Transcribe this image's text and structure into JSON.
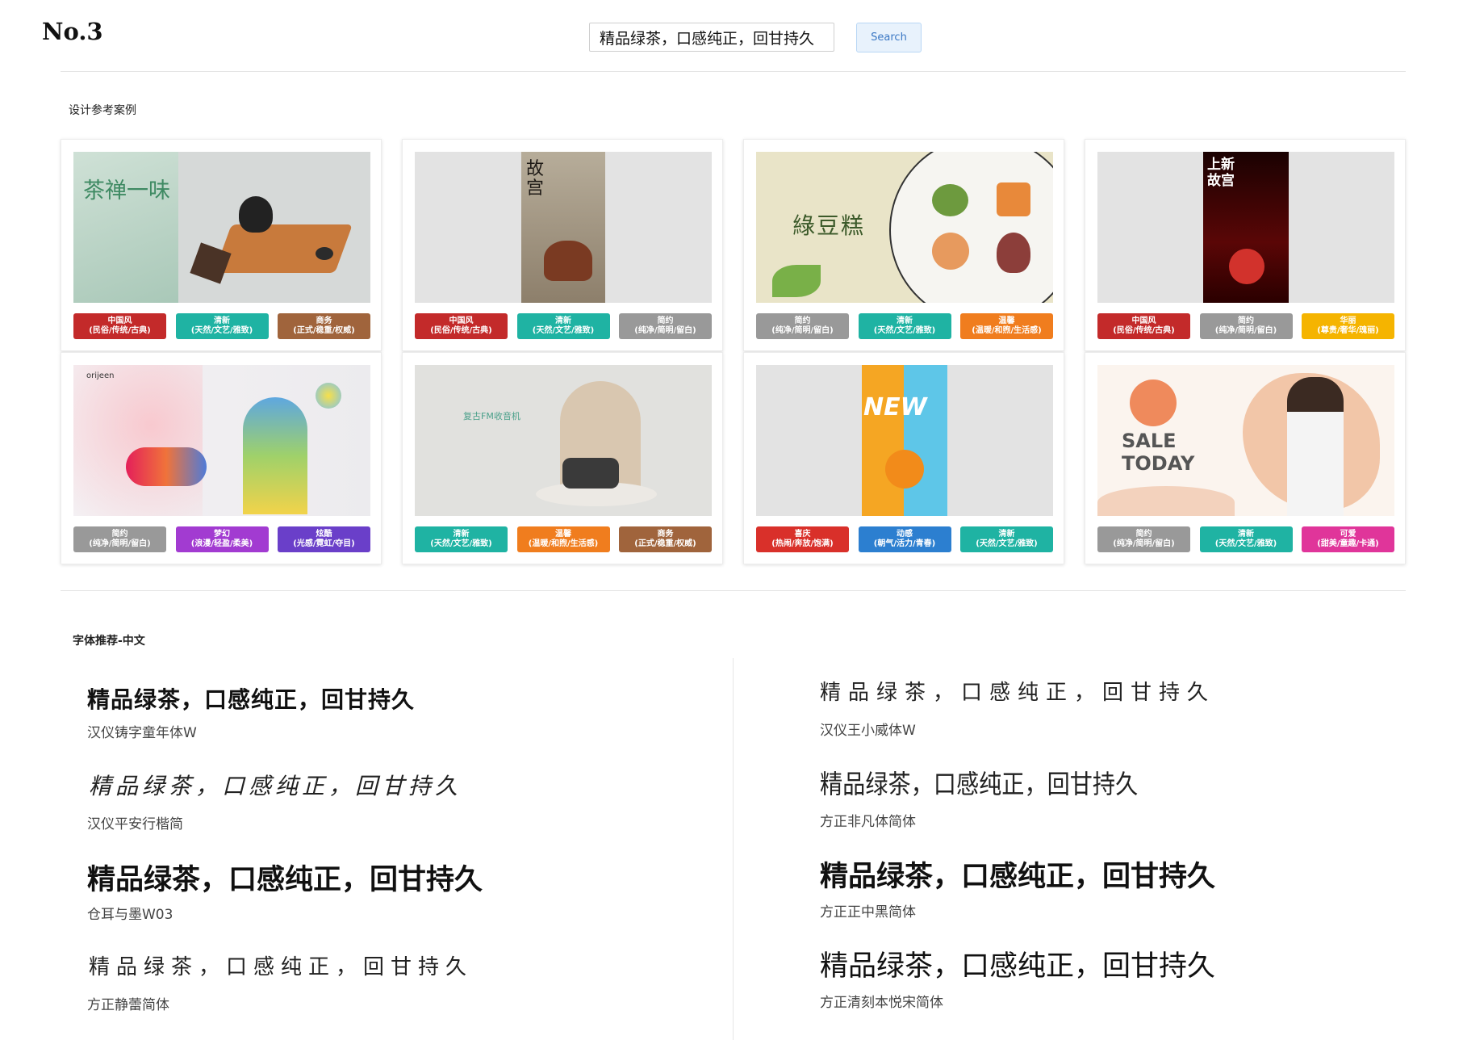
{
  "header": {
    "logo": "No.3",
    "search_value": "精品绿茶，口感纯正，回甘持久",
    "search_button": "Search"
  },
  "section_cases": {
    "title": "设计参考案例",
    "cards": [
      {
        "thumb_text": "茶禅一味",
        "tags": [
          {
            "name": "中国风",
            "desc": "(民俗/传统/古典)",
            "color": "#c32a2a"
          },
          {
            "name": "清新",
            "desc": "(天然/文艺/雅致)",
            "color": "#1fb3a3"
          },
          {
            "name": "商务",
            "desc": "(正式/稳重/权威)",
            "color": "#a0643c"
          }
        ]
      },
      {
        "thumb_text": "故宫",
        "tags": [
          {
            "name": "中国风",
            "desc": "(民俗/传统/古典)",
            "color": "#c32a2a"
          },
          {
            "name": "清新",
            "desc": "(天然/文艺/雅致)",
            "color": "#1fb3a3"
          },
          {
            "name": "简约",
            "desc": "(纯净/简明/留白)",
            "color": "#999999"
          }
        ]
      },
      {
        "thumb_text": "綠豆糕",
        "tags": [
          {
            "name": "简约",
            "desc": "(纯净/简明/留白)",
            "color": "#999999"
          },
          {
            "name": "清新",
            "desc": "(天然/文艺/雅致)",
            "color": "#1fb3a3"
          },
          {
            "name": "温馨",
            "desc": "(温暖/和煦/生活感)",
            "color": "#f07d1e"
          }
        ]
      },
      {
        "thumb_text": "上新故宫",
        "tags": [
          {
            "name": "中国风",
            "desc": "(民俗/传统/古典)",
            "color": "#c32a2a"
          },
          {
            "name": "简约",
            "desc": "(纯净/简明/留白)",
            "color": "#999999"
          },
          {
            "name": "华丽",
            "desc": "(尊贵/奢华/瑰丽)",
            "color": "#f5b400"
          }
        ]
      },
      {
        "thumb_text": "orijeen",
        "tags": [
          {
            "name": "简约",
            "desc": "(纯净/简明/留白)",
            "color": "#999999"
          },
          {
            "name": "梦幻",
            "desc": "(浪漫/轻盈/柔美)",
            "color": "#a23bd1"
          },
          {
            "name": "炫酷",
            "desc": "(光感/霓虹/夺目)",
            "color": "#6a3fc9"
          }
        ]
      },
      {
        "thumb_text": "复古FM收音机",
        "tags": [
          {
            "name": "清新",
            "desc": "(天然/文艺/雅致)",
            "color": "#1fb3a3"
          },
          {
            "name": "温馨",
            "desc": "(温暖/和煦/生活感)",
            "color": "#f07d1e"
          },
          {
            "name": "商务",
            "desc": "(正式/稳重/权威)",
            "color": "#a0643c"
          }
        ]
      },
      {
        "thumb_text": "NEW",
        "tags": [
          {
            "name": "喜庆",
            "desc": "(热闹/奔放/饱满)",
            "color": "#d9302a"
          },
          {
            "name": "动感",
            "desc": "(朝气/活力/青春)",
            "color": "#2c7fd0"
          },
          {
            "name": "清新",
            "desc": "(天然/文艺/雅致)",
            "color": "#1fb3a3"
          }
        ]
      },
      {
        "thumb_text": "SALE TODAY",
        "tags": [
          {
            "name": "简约",
            "desc": "(纯净/简明/留白)",
            "color": "#999999"
          },
          {
            "name": "清新",
            "desc": "(天然/文艺/雅致)",
            "color": "#1fb3a3"
          },
          {
            "name": "可爱",
            "desc": "(甜美/童趣/卡通)",
            "color": "#e0359a"
          }
        ]
      }
    ]
  },
  "section_fonts": {
    "title": "字体推荐-中文",
    "sample_text": "精品绿茶，口感纯正，回甘持久",
    "fonts": [
      {
        "name": "汉仪铸字童年体W"
      },
      {
        "name": "汉仪王小威体W"
      },
      {
        "name": "汉仪平安行楷简"
      },
      {
        "name": "方正非凡体简体"
      },
      {
        "name": "仓耳与墨W03"
      },
      {
        "name": "方正正中黑简体"
      },
      {
        "name": "方正静蕾简体"
      },
      {
        "name": "方正清刻本悦宋简体"
      }
    ]
  }
}
